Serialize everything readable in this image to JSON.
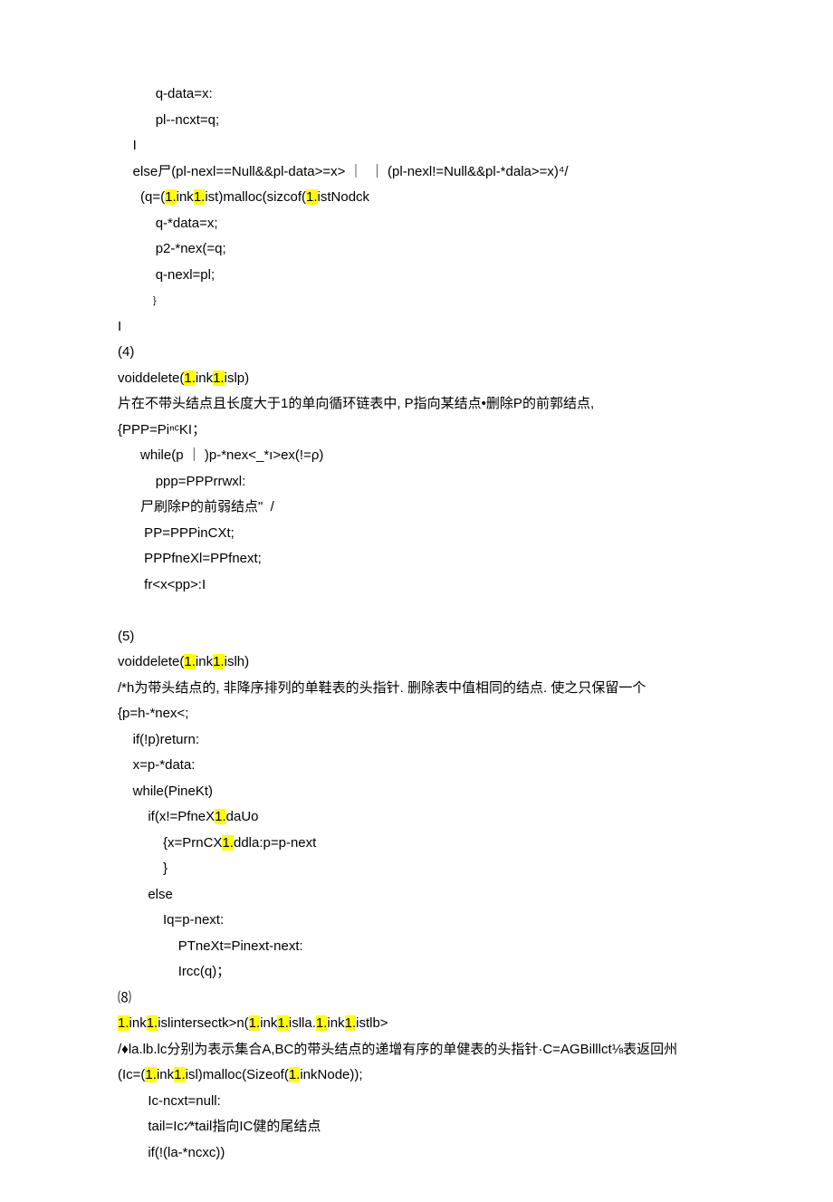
{
  "lines": [
    {
      "indent": 10,
      "segs": [
        {
          "t": "q-data=x:"
        }
      ]
    },
    {
      "indent": 10,
      "segs": [
        {
          "t": "pl--ncxt=q;"
        }
      ]
    },
    {
      "indent": 4,
      "segs": [
        {
          "t": "I"
        }
      ]
    },
    {
      "indent": 4,
      "segs": [
        {
          "t": "else尸(pl-nexl==Null&&pl-data>=x> ｜  ｜ (pl-nexl!=Null&&pl-*dala>=x)⁴/"
        }
      ]
    },
    {
      "indent": 6,
      "segs": [
        {
          "t": "(q=("
        },
        {
          "t": "1.",
          "hl": true
        },
        {
          "t": "ink"
        },
        {
          "t": "1.",
          "hl": true
        },
        {
          "t": "ist)malloc(sizcof("
        },
        {
          "t": "1.",
          "hl": true
        },
        {
          "t": "istNodck"
        }
      ]
    },
    {
      "indent": 10,
      "segs": [
        {
          "t": "q-*data=x;"
        }
      ]
    },
    {
      "indent": 10,
      "segs": [
        {
          "t": "p2-*nex(=q;"
        }
      ]
    },
    {
      "indent": 10,
      "segs": [
        {
          "t": "q-nexl=pl;"
        }
      ]
    },
    {
      "indent": 8,
      "segs": [
        {
          "t": "﹜"
        }
      ]
    },
    {
      "indent": 0,
      "segs": [
        {
          "t": "I"
        }
      ]
    },
    {
      "indent": 0,
      "segs": [
        {
          "t": "(4)"
        }
      ]
    },
    {
      "indent": 0,
      "segs": [
        {
          "t": "voiddelete("
        },
        {
          "t": "1.",
          "hl": true
        },
        {
          "t": "ink"
        },
        {
          "t": "1.",
          "hl": true
        },
        {
          "t": "islp)"
        }
      ]
    },
    {
      "indent": 0,
      "segs": [
        {
          "t": "片在不带头结点且长度大于1的单向循环链表中, P指向某结点•删除P的前郭结点,"
        }
      ]
    },
    {
      "indent": 0,
      "segs": [
        {
          "t": "{PPP=PiⁿᶜKI；"
        }
      ]
    },
    {
      "indent": 6,
      "segs": [
        {
          "t": "while(p ｜ )p-*nex<_*ı>ex(!=ρ)"
        }
      ]
    },
    {
      "indent": 10,
      "segs": [
        {
          "t": "ppp=PPPrrwxl:"
        }
      ]
    },
    {
      "indent": 6,
      "segs": [
        {
          "t": "尸刷除P的前弱结点\"  /"
        }
      ]
    },
    {
      "indent": 6,
      "segs": [
        {
          "t": " PP=PPPinCXt;"
        }
      ]
    },
    {
      "indent": 6,
      "segs": [
        {
          "t": " PPPfneXl=PPfnext;"
        }
      ]
    },
    {
      "indent": 6,
      "segs": [
        {
          "t": " fr<x<pp>:I"
        }
      ]
    },
    {
      "indent": 0,
      "segs": [
        {
          "t": ""
        }
      ]
    },
    {
      "indent": 0,
      "segs": [
        {
          "t": "(5)"
        }
      ]
    },
    {
      "indent": 0,
      "segs": [
        {
          "t": "voiddelete("
        },
        {
          "t": "1.",
          "hl": true
        },
        {
          "t": "ink"
        },
        {
          "t": "1.",
          "hl": true
        },
        {
          "t": "islh)"
        }
      ]
    },
    {
      "indent": 0,
      "segs": [
        {
          "t": "/*h为带头结点的, 非降序排列的单鞋表的头指针. 删除表中值相同的结点. 使之只保留一个"
        }
      ]
    },
    {
      "indent": 0,
      "segs": [
        {
          "t": "{p=h-*nex<;"
        }
      ]
    },
    {
      "indent": 4,
      "segs": [
        {
          "t": "if(!p)return:"
        }
      ]
    },
    {
      "indent": 4,
      "segs": [
        {
          "t": "x=p-*data:"
        }
      ]
    },
    {
      "indent": 4,
      "segs": [
        {
          "t": "while(PineKt)"
        }
      ]
    },
    {
      "indent": 8,
      "segs": [
        {
          "t": "if(x!=PfneX"
        },
        {
          "t": "1.",
          "hl": true
        },
        {
          "t": "daUo"
        }
      ]
    },
    {
      "indent": 12,
      "segs": [
        {
          "t": "{x=PrnCX"
        },
        {
          "t": "1.",
          "hl": true
        },
        {
          "t": "ddla:p=p-next"
        }
      ]
    },
    {
      "indent": 12,
      "segs": [
        {
          "t": "}"
        }
      ]
    },
    {
      "indent": 8,
      "segs": [
        {
          "t": "else"
        }
      ]
    },
    {
      "indent": 12,
      "segs": [
        {
          "t": "Iq=p-next:"
        }
      ]
    },
    {
      "indent": 16,
      "segs": [
        {
          "t": "PTneXt=Pinext-next:"
        }
      ]
    },
    {
      "indent": 16,
      "segs": [
        {
          "t": "Ircc(q)；"
        }
      ]
    },
    {
      "indent": 0,
      "segs": [
        {
          "t": "⑻"
        }
      ]
    },
    {
      "indent": 0,
      "segs": [
        {
          "t": "1.",
          "hl": true
        },
        {
          "t": "ink"
        },
        {
          "t": "1.",
          "hl": true
        },
        {
          "t": "islintersectk>n("
        },
        {
          "t": "1.",
          "hl": true
        },
        {
          "t": "ink"
        },
        {
          "t": "1.",
          "hl": true
        },
        {
          "t": "islla."
        },
        {
          "t": "1.",
          "hl": true
        },
        {
          "t": "ink"
        },
        {
          "t": "1.",
          "hl": true
        },
        {
          "t": "istlb>"
        }
      ]
    },
    {
      "indent": 0,
      "segs": [
        {
          "t": "/♦la.lb.lc分别为表示集合A,BC的带头结点的递增有序的单健表的头指针·C=AGBilllct⅛表返回州"
        }
      ]
    },
    {
      "indent": 0,
      "segs": [
        {
          "t": "(Ic=("
        },
        {
          "t": "1.",
          "hl": true
        },
        {
          "t": "ink"
        },
        {
          "t": "1.",
          "hl": true
        },
        {
          "t": "isl)malloc(Sizeof("
        },
        {
          "t": "1.",
          "hl": true
        },
        {
          "t": "inkNode));"
        }
      ]
    },
    {
      "indent": 8,
      "segs": [
        {
          "t": "Ic-ncxt=null:"
        }
      ]
    },
    {
      "indent": 8,
      "segs": [
        {
          "t": "tail=Ic∶⁄*tail指向IC健的尾结点"
        }
      ]
    },
    {
      "indent": 8,
      "segs": [
        {
          "t": "if(!(la-*ncxc))"
        }
      ]
    }
  ]
}
